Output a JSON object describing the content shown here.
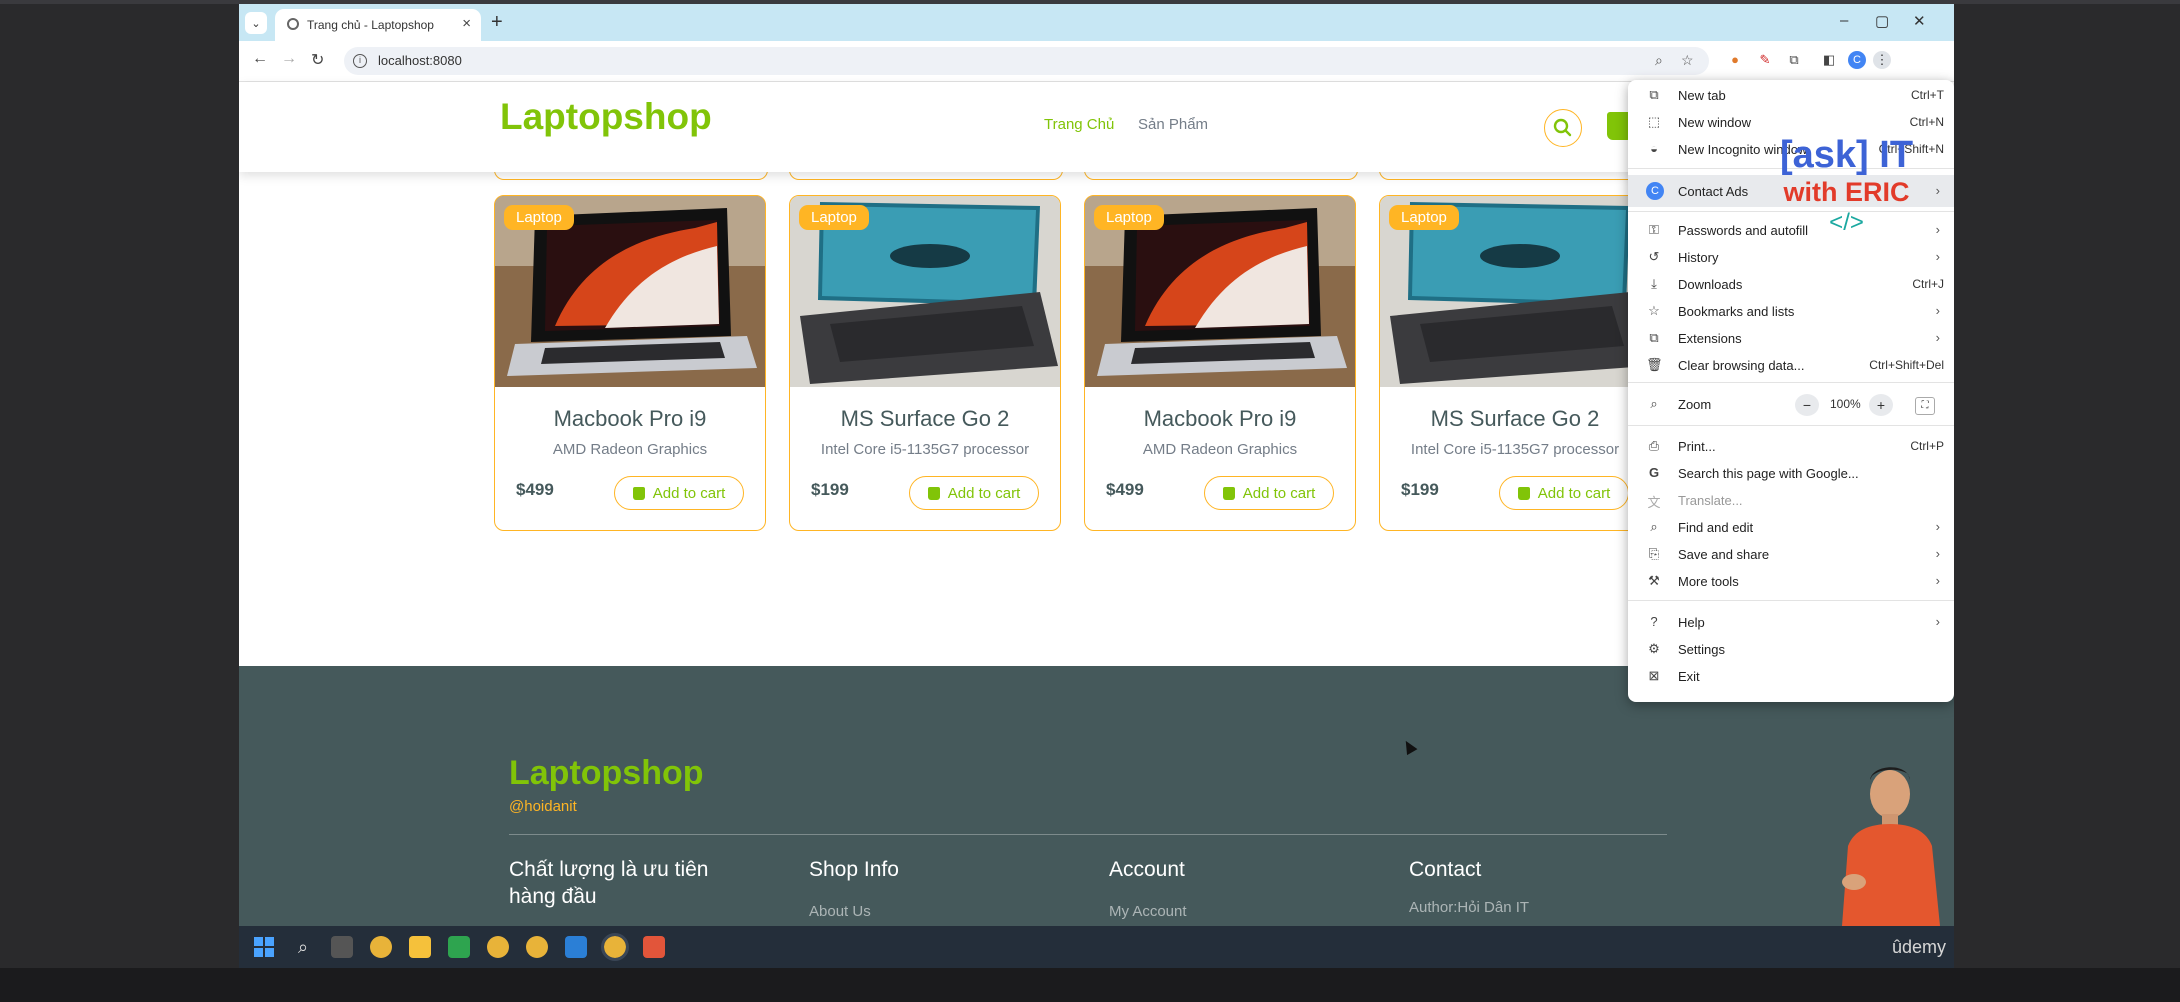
{
  "browser": {
    "tab_title": "Trang chủ - Laptopshop",
    "url": "localhost:8080",
    "window_controls": [
      "–",
      "▢",
      "✕"
    ],
    "new_tab_symbol": "+"
  },
  "site": {
    "logo": "Laptopshop",
    "nav": [
      "Trang Chủ",
      "Sản Phẩm"
    ]
  },
  "products": [
    {
      "badge": "Laptop",
      "name": "Macbook Pro i9",
      "desc": "AMD Radeon Graphics",
      "price": "$499",
      "button": "Add to cart",
      "image": "macbook"
    },
    {
      "badge": "Laptop",
      "name": "MS Surface Go 2",
      "desc": "Intel Core i5-1135G7 processor",
      "price": "$199",
      "button": "Add to cart",
      "image": "surface"
    },
    {
      "badge": "Laptop",
      "name": "Macbook Pro i9",
      "desc": "AMD Radeon Graphics",
      "price": "$499",
      "button": "Add to cart",
      "image": "macbook"
    },
    {
      "badge": "Laptop",
      "name": "MS Surface Go 2",
      "desc": "Intel Core i5-1135G7 processor",
      "price": "$199",
      "button": "Add to cart",
      "image": "surface"
    }
  ],
  "footer": {
    "logo": "Laptopshop",
    "handle": "@hoidanit",
    "headings": [
      "Chất lượng là ưu tiên hàng đầu",
      "Shop Info",
      "Account",
      "Contact"
    ],
    "links": [
      "About Us",
      "My Account",
      "Author:Hỏi Dân IT"
    ]
  },
  "menu": {
    "items": [
      {
        "icon": "new-tab-icon",
        "label": "New tab",
        "shortcut": "Ctrl+T"
      },
      {
        "icon": "new-window-icon",
        "label": "New window",
        "shortcut": "Ctrl+N"
      },
      {
        "icon": "incognito-icon",
        "label": "New Incognito window",
        "shortcut": "Ctrl+Shift+N"
      },
      {
        "icon": "profile-avatar",
        "label": "Contact Ads",
        "avatar_letter": "C"
      },
      {
        "icon": "key-icon",
        "label": "Passwords and autofill"
      },
      {
        "icon": "history-icon",
        "label": "History"
      },
      {
        "icon": "download-icon",
        "label": "Downloads",
        "shortcut": "Ctrl+J"
      },
      {
        "icon": "star-icon",
        "label": "Bookmarks and lists"
      },
      {
        "icon": "puzzle-icon",
        "label": "Extensions"
      },
      {
        "icon": "trash-icon",
        "label": "Clear browsing data...",
        "shortcut": "Ctrl+Shift+Del"
      },
      {
        "icon": "zoom-icon",
        "label": "Zoom",
        "zoom_value": "100%",
        "minus": "−",
        "plus": "+"
      },
      {
        "icon": "print-icon",
        "label": "Print...",
        "shortcut": "Ctrl+P"
      },
      {
        "icon": "google-icon",
        "label": "Search this page with Google..."
      },
      {
        "icon": "translate-icon",
        "label": "Translate..."
      },
      {
        "icon": "find-icon",
        "label": "Find and edit"
      },
      {
        "icon": "save-icon",
        "label": "Save and share"
      },
      {
        "icon": "tools-icon",
        "label": "More tools"
      },
      {
        "icon": "help-icon",
        "label": "Help"
      },
      {
        "icon": "settings-icon",
        "label": "Settings"
      },
      {
        "icon": "exit-icon",
        "label": "Exit"
      }
    ]
  },
  "overlay": {
    "watermark": [
      "[ask] IT",
      "with ERIC",
      "</>"
    ],
    "udemy": "ûdemy"
  },
  "colors": {
    "brand_green": "#81c408",
    "accent_orange": "#ffb524",
    "footer_bg": "#45595b",
    "tabbar_bg": "#c7e7f4"
  }
}
